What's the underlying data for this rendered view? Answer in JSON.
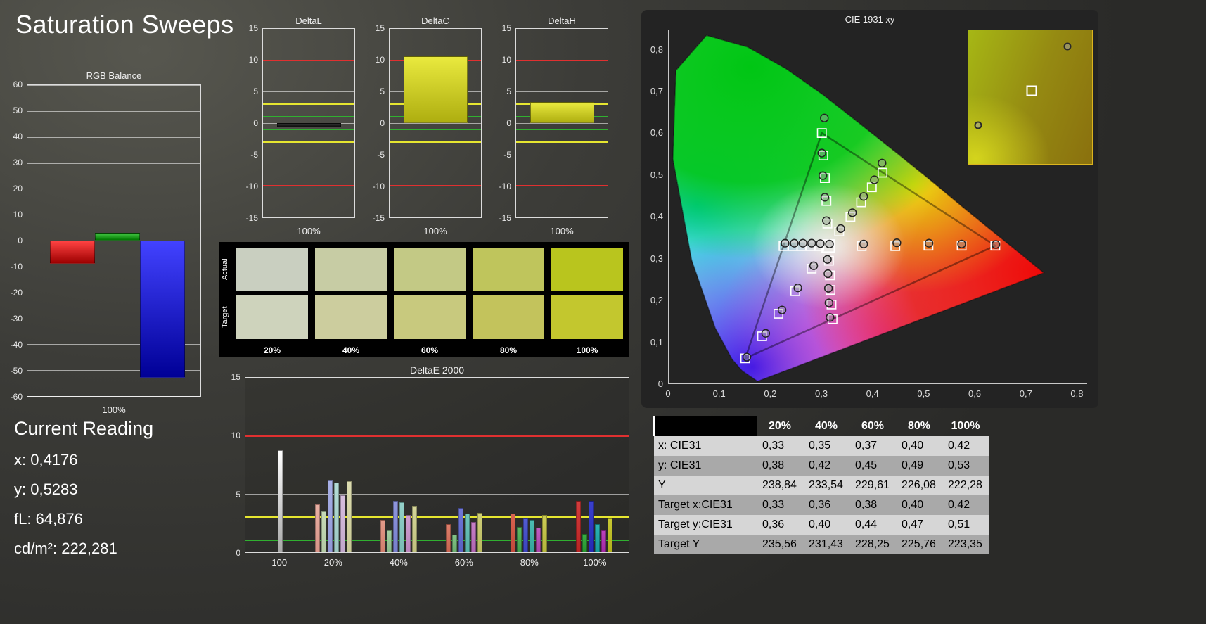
{
  "page": {
    "title": "Saturation Sweeps"
  },
  "current_reading": {
    "title": "Current Reading",
    "lines": [
      "x: 0,4176",
      "y: 0,5283",
      "fL: 64,876",
      "cd/m²: 222,281"
    ]
  },
  "chart_data": [
    {
      "type": "bar",
      "title": "RGB Balance",
      "categories": [
        "Red",
        "Green",
        "Blue"
      ],
      "values": [
        -9,
        3,
        -53
      ],
      "xlabel": "100%",
      "ylim": [
        -60,
        60
      ]
    },
    {
      "type": "bar",
      "title": "DeltaL / DeltaC / DeltaH",
      "categories": [
        "DeltaL",
        "DeltaC",
        "DeltaH"
      ],
      "values": [
        -0.7,
        10.6,
        3.4
      ],
      "xlabel": "100%",
      "ylim": [
        -15,
        15
      ]
    },
    {
      "type": "bar",
      "title": "DeltaE 2000",
      "categories": [
        "100",
        "20%",
        "40%",
        "60%",
        "80%",
        "100%"
      ],
      "series": [
        {
          "name": "white",
          "values": [
            8.8,
            null,
            null,
            null,
            null,
            null
          ]
        },
        {
          "name": "red",
          "values": [
            null,
            4.1,
            2.8,
            2.4,
            3.3,
            4.4
          ]
        },
        {
          "name": "green",
          "values": [
            null,
            3.5,
            1.9,
            1.5,
            2.2,
            1.6
          ]
        },
        {
          "name": "blue",
          "values": [
            null,
            6.2,
            4.4,
            3.8,
            2.9,
            4.4
          ]
        },
        {
          "name": "cyan",
          "values": [
            null,
            6.0,
            4.3,
            3.3,
            2.8,
            2.4
          ]
        },
        {
          "name": "magenta",
          "values": [
            null,
            4.9,
            3.2,
            2.6,
            2.1,
            1.9
          ]
        },
        {
          "name": "yellow",
          "values": [
            null,
            6.1,
            4.0,
            3.4,
            3.2,
            2.9
          ]
        }
      ],
      "ylim": [
        0,
        15
      ],
      "ref_lines": [
        10,
        3,
        1
      ]
    }
  ],
  "rgb_balance": {
    "title": "RGB Balance",
    "xlabel": "100%",
    "ylim": [
      -60,
      60
    ],
    "yticks": [
      60,
      50,
      40,
      30,
      20,
      10,
      0,
      -10,
      -20,
      -30,
      -40,
      -50,
      -60
    ],
    "bars": [
      {
        "name": "red-bar",
        "value": -9,
        "color_top": "#ff4242",
        "color_bottom": "#9c0000"
      },
      {
        "name": "green-bar",
        "value": 3,
        "color_top": "#42c642",
        "color_bottom": "#007800"
      },
      {
        "name": "blue-bar",
        "value": -53,
        "color_top": "#4242ff",
        "color_bottom": "#000096"
      }
    ]
  },
  "delta_axis": {
    "ylim": [
      -15,
      15
    ],
    "yticks": [
      15,
      10,
      5,
      0,
      -5,
      -10,
      -15
    ],
    "xlabel": "100%",
    "ref_lines": [
      {
        "value": 10,
        "color": "#e03030"
      },
      {
        "value": -10,
        "color": "#e03030"
      },
      {
        "value": 3,
        "color": "#e6e630"
      },
      {
        "value": -3,
        "color": "#e6e630"
      },
      {
        "value": 1,
        "color": "#30b030"
      },
      {
        "value": -1,
        "color": "#30b030"
      }
    ]
  },
  "delta_charts": [
    {
      "title": "DeltaL",
      "value": -0.7,
      "color_top": "#2e2e2e",
      "color_bottom": "#0e0e0e"
    },
    {
      "title": "DeltaC",
      "value": 10.6,
      "color_top": "#e9e93e",
      "color_bottom": "#aeae10"
    },
    {
      "title": "DeltaH",
      "value": 3.4,
      "color_top": "#e9e93e",
      "color_bottom": "#aeae10"
    }
  ],
  "swatches": {
    "row_labels": [
      "Actual",
      "Target"
    ],
    "col_labels": [
      "20%",
      "40%",
      "60%",
      "80%",
      "100%"
    ],
    "actual": [
      "#c9cfc0",
      "#c7cca4",
      "#c3c985",
      "#bfc55c",
      "#b9c51e"
    ],
    "target": [
      "#ced3bc",
      "#cccd9e",
      "#c8c97e",
      "#c3c35c",
      "#c3c72e"
    ]
  },
  "deltae": {
    "title": "DeltaE 2000",
    "ylim": [
      0,
      15
    ],
    "yticks": [
      15,
      10,
      5,
      0
    ],
    "ref_lines": [
      {
        "value": 10,
        "color": "#e03030"
      },
      {
        "value": 3,
        "color": "#e6e630"
      },
      {
        "value": 1,
        "color": "#30b030"
      }
    ],
    "groups": [
      {
        "label": "100",
        "center": 9,
        "bars": [
          {
            "value": 8.8,
            "color_top": "#ffffff",
            "color_bottom": "#a8a8a8"
          }
        ]
      },
      {
        "label": "20%",
        "center": 23,
        "bars": [
          {
            "value": 4.1,
            "color_top": "#e8b0a4",
            "color_bottom": "#d89488"
          },
          {
            "value": 3.5,
            "color_top": "#c6dab8",
            "color_bottom": "#b2caa4"
          },
          {
            "value": 6.2,
            "color_top": "#a8b0e6",
            "color_bottom": "#9098d6"
          },
          {
            "value": 6.0,
            "color_top": "#b4dcd6",
            "color_bottom": "#9cc8c2"
          },
          {
            "value": 4.9,
            "color_top": "#d6bede",
            "color_bottom": "#c2a8cc"
          },
          {
            "value": 6.1,
            "color_top": "#dcdcb0",
            "color_bottom": "#c8c896"
          }
        ]
      },
      {
        "label": "40%",
        "center": 40,
        "bars": [
          {
            "value": 2.8,
            "color_top": "#e29a8a",
            "color_bottom": "#d07e6c"
          },
          {
            "value": 1.9,
            "color_top": "#a2cda0",
            "color_bottom": "#8aba88"
          },
          {
            "value": 4.4,
            "color_top": "#8f96dd",
            "color_bottom": "#767ecb"
          },
          {
            "value": 4.3,
            "color_top": "#93cfc8",
            "color_bottom": "#79bcb4"
          },
          {
            "value": 3.2,
            "color_top": "#cf9fd0",
            "color_bottom": "#ba86bc"
          },
          {
            "value": 4.0,
            "color_top": "#d5d59a",
            "color_bottom": "#c0c07e"
          }
        ]
      },
      {
        "label": "60%",
        "center": 57,
        "bars": [
          {
            "value": 2.4,
            "color_top": "#dd7f6b",
            "color_bottom": "#c86350"
          },
          {
            "value": 1.5,
            "color_top": "#84c287",
            "color_bottom": "#6aac6e"
          },
          {
            "value": 3.8,
            "color_top": "#7078d6",
            "color_bottom": "#5860c2"
          },
          {
            "value": 3.3,
            "color_top": "#6fc5bc",
            "color_bottom": "#55b0a6"
          },
          {
            "value": 2.6,
            "color_top": "#c67fc6",
            "color_bottom": "#b064b0"
          },
          {
            "value": 3.4,
            "color_top": "#cfcf7a",
            "color_bottom": "#b8b85e"
          }
        ]
      },
      {
        "label": "80%",
        "center": 74,
        "bars": [
          {
            "value": 3.3,
            "color_top": "#d96450",
            "color_bottom": "#c2483a"
          },
          {
            "value": 2.2,
            "color_top": "#5cb863",
            "color_bottom": "#42a04a"
          },
          {
            "value": 2.9,
            "color_top": "#525cd2",
            "color_bottom": "#3a44bc"
          },
          {
            "value": 2.8,
            "color_top": "#4cbcb2",
            "color_bottom": "#34a49a"
          },
          {
            "value": 2.1,
            "color_top": "#c05cc0",
            "color_bottom": "#a844a8"
          },
          {
            "value": 3.2,
            "color_top": "#cccc56",
            "color_bottom": "#b4b43c"
          }
        ]
      },
      {
        "label": "100%",
        "center": 91,
        "bars": [
          {
            "value": 4.4,
            "color_top": "#d23c3c",
            "color_bottom": "#b82424"
          },
          {
            "value": 1.6,
            "color_top": "#3aae44",
            "color_bottom": "#26942e"
          },
          {
            "value": 4.4,
            "color_top": "#3a40cc",
            "color_bottom": "#242ab4"
          },
          {
            "value": 2.4,
            "color_top": "#2cb4b4",
            "color_bottom": "#189a9a"
          },
          {
            "value": 1.9,
            "color_top": "#bc40bc",
            "color_bottom": "#a228a2"
          },
          {
            "value": 2.9,
            "color_top": "#c8c832",
            "color_bottom": "#b0b01c"
          }
        ]
      }
    ]
  },
  "cie": {
    "title": "CIE 1931 xy",
    "xlim": [
      0,
      0.82
    ],
    "ylim": [
      0,
      0.848
    ],
    "xtick_values": [
      0,
      0.1,
      0.2,
      0.3,
      0.4,
      0.5,
      0.6,
      0.7,
      0.8
    ],
    "xtick_labels": [
      "0",
      "0,1",
      "0,2",
      "0,3",
      "0,4",
      "0,5",
      "0,6",
      "0,7",
      "0,8"
    ],
    "ytick_values": [
      0,
      0.1,
      0.2,
      0.3,
      0.4,
      0.5,
      0.6,
      0.7,
      0.8
    ],
    "ytick_labels": [
      "0",
      "0,1",
      "0,2",
      "0,3",
      "0,4",
      "0,5",
      "0,6",
      "0,7",
      "0,8"
    ],
    "white_point": [
      0.3127,
      0.329
    ],
    "triangle": [
      [
        0.64,
        0.33
      ],
      [
        0.3,
        0.6
      ],
      [
        0.15,
        0.06
      ]
    ],
    "targets": [
      [
        0.378,
        0.329
      ],
      [
        0.444,
        0.329
      ],
      [
        0.509,
        0.33
      ],
      [
        0.574,
        0.33
      ],
      [
        0.64,
        0.33
      ],
      [
        0.311,
        0.383
      ],
      [
        0.309,
        0.437
      ],
      [
        0.306,
        0.492
      ],
      [
        0.303,
        0.546
      ],
      [
        0.3,
        0.6
      ],
      [
        0.28,
        0.275
      ],
      [
        0.248,
        0.221
      ],
      [
        0.215,
        0.167
      ],
      [
        0.183,
        0.113
      ],
      [
        0.15,
        0.06
      ],
      [
        0.295,
        0.329
      ],
      [
        0.278,
        0.329
      ],
      [
        0.26,
        0.329
      ],
      [
        0.243,
        0.329
      ],
      [
        0.225,
        0.329
      ],
      [
        0.314,
        0.294
      ],
      [
        0.316,
        0.259
      ],
      [
        0.317,
        0.224
      ],
      [
        0.319,
        0.189
      ],
      [
        0.321,
        0.154
      ],
      [
        0.334,
        0.364
      ],
      [
        0.356,
        0.399
      ],
      [
        0.377,
        0.434
      ],
      [
        0.398,
        0.47
      ],
      [
        0.419,
        0.505
      ]
    ],
    "measurements": [
      [
        0.382,
        0.334
      ],
      [
        0.447,
        0.337
      ],
      [
        0.51,
        0.336
      ],
      [
        0.574,
        0.334
      ],
      [
        0.641,
        0.333
      ],
      [
        0.309,
        0.39
      ],
      [
        0.306,
        0.446
      ],
      [
        0.302,
        0.498
      ],
      [
        0.3,
        0.552
      ],
      [
        0.305,
        0.636
      ],
      [
        0.284,
        0.282
      ],
      [
        0.253,
        0.229
      ],
      [
        0.222,
        0.176
      ],
      [
        0.19,
        0.12
      ],
      [
        0.153,
        0.063
      ],
      [
        0.297,
        0.335
      ],
      [
        0.28,
        0.336
      ],
      [
        0.263,
        0.336
      ],
      [
        0.246,
        0.336
      ],
      [
        0.228,
        0.336
      ],
      [
        0.311,
        0.297
      ],
      [
        0.312,
        0.263
      ],
      [
        0.313,
        0.228
      ],
      [
        0.314,
        0.193
      ],
      [
        0.316,
        0.158
      ],
      [
        0.337,
        0.371
      ],
      [
        0.36,
        0.409
      ],
      [
        0.382,
        0.448
      ],
      [
        0.403,
        0.488
      ],
      [
        0.418,
        0.528
      ],
      [
        0.315,
        0.334
      ]
    ],
    "inset_markers": [
      {
        "type": "circle",
        "x": 80,
        "y": 12
      },
      {
        "type": "square",
        "x": 51,
        "y": 45
      },
      {
        "type": "circle",
        "x": 8,
        "y": 71
      }
    ]
  },
  "table": {
    "col_headers": [
      "20%",
      "40%",
      "60%",
      "80%",
      "100%"
    ],
    "rows": [
      {
        "label": "x: CIE31",
        "values": [
          "0,33",
          "0,35",
          "0,37",
          "0,40",
          "0,42"
        ]
      },
      {
        "label": "y: CIE31",
        "values": [
          "0,38",
          "0,42",
          "0,45",
          "0,49",
          "0,53"
        ]
      },
      {
        "label": "Y",
        "values": [
          "238,84",
          "233,54",
          "229,61",
          "226,08",
          "222,28"
        ]
      },
      {
        "label": "Target x:CIE31",
        "values": [
          "0,33",
          "0,36",
          "0,38",
          "0,40",
          "0,42"
        ]
      },
      {
        "label": "Target y:CIE31",
        "values": [
          "0,36",
          "0,40",
          "0,44",
          "0,47",
          "0,51"
        ]
      },
      {
        "label": "Target Y",
        "values": [
          "235,56",
          "231,43",
          "228,25",
          "225,76",
          "223,35"
        ]
      }
    ]
  }
}
